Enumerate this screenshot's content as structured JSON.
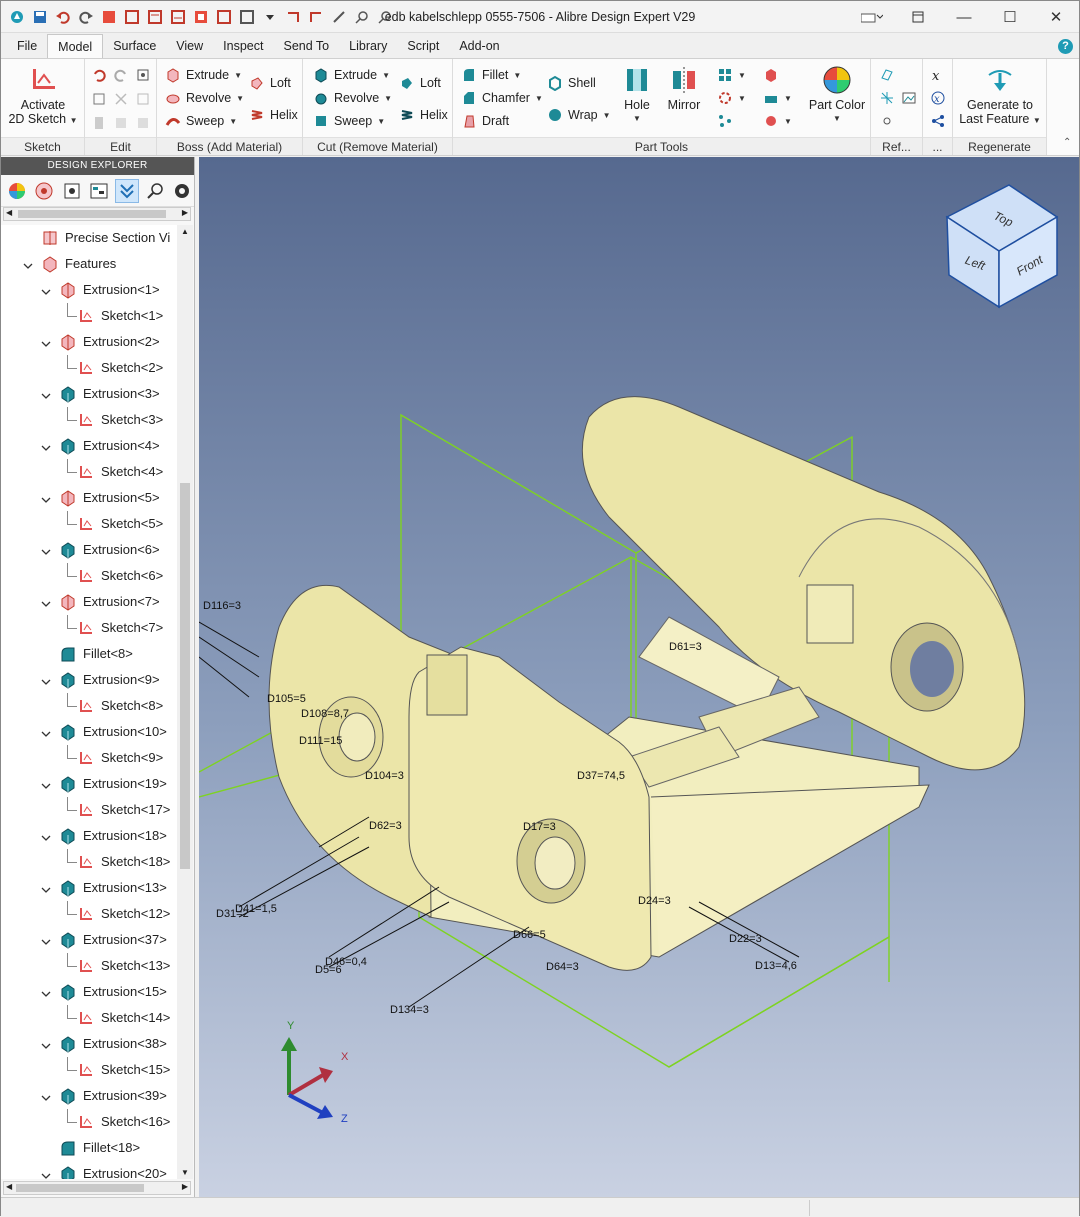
{
  "window": {
    "title": "edb kabelschlepp 0555-7506 - Alibre Design Expert V29",
    "minimize_glyph": "—",
    "maximize_glyph": "☐",
    "close_glyph": "✕"
  },
  "menu": [
    "File",
    "Model",
    "Surface",
    "View",
    "Inspect",
    "Send To",
    "Library",
    "Script",
    "Add-on"
  ],
  "help_glyph": "?",
  "ribbon": {
    "sketch": {
      "activate_line1": "Activate",
      "activate_line2": "2D Sketch",
      "label": "Sketch"
    },
    "edit": {
      "label": "Edit"
    },
    "boss": {
      "extrude": "Extrude",
      "revolve": "Revolve",
      "sweep": "Sweep",
      "loft": "Loft",
      "helix": "Helix",
      "label": "Boss (Add Material)"
    },
    "cut": {
      "extrude": "Extrude",
      "revolve": "Revolve",
      "sweep": "Sweep",
      "loft": "Loft",
      "helix": "Helix",
      "label": "Cut (Remove Material)"
    },
    "part_tools": {
      "fillet": "Fillet",
      "chamfer": "Chamfer",
      "draft": "Draft",
      "shell": "Shell",
      "wrap": "Wrap",
      "hole": "Hole",
      "mirror": "Mirror",
      "part_color": "Part Color",
      "label": "Part Tools"
    },
    "ref": {
      "label": "Ref..."
    },
    "more": {
      "label": "..."
    },
    "regenerate": {
      "line1": "Generate to",
      "line2": "Last Feature",
      "label": "Regenerate"
    }
  },
  "explorer": {
    "title": "DESIGN EXPLORER",
    "items": [
      {
        "label": "Precise Section Vi",
        "depth": 1,
        "icon": "section-icon",
        "toggle": ""
      },
      {
        "label": "Features",
        "depth": 1,
        "icon": "features-icon",
        "toggle": "v"
      },
      {
        "label": "Extrusion<1>",
        "depth": 2,
        "icon": "boss-icon",
        "toggle": "v"
      },
      {
        "label": "Sketch<1>",
        "depth": 3,
        "icon": "sketch-icon",
        "toggle": ""
      },
      {
        "label": "Extrusion<2>",
        "depth": 2,
        "icon": "boss-icon",
        "toggle": "v"
      },
      {
        "label": "Sketch<2>",
        "depth": 3,
        "icon": "sketch-icon",
        "toggle": ""
      },
      {
        "label": "Extrusion<3>",
        "depth": 2,
        "icon": "cut-icon",
        "toggle": "v"
      },
      {
        "label": "Sketch<3>",
        "depth": 3,
        "icon": "sketch-icon",
        "toggle": ""
      },
      {
        "label": "Extrusion<4>",
        "depth": 2,
        "icon": "cut-icon",
        "toggle": "v"
      },
      {
        "label": "Sketch<4>",
        "depth": 3,
        "icon": "sketch-icon",
        "toggle": ""
      },
      {
        "label": "Extrusion<5>",
        "depth": 2,
        "icon": "boss-icon",
        "toggle": "v"
      },
      {
        "label": "Sketch<5>",
        "depth": 3,
        "icon": "sketch-icon",
        "toggle": ""
      },
      {
        "label": "Extrusion<6>",
        "depth": 2,
        "icon": "cut-icon",
        "toggle": "v"
      },
      {
        "label": "Sketch<6>",
        "depth": 3,
        "icon": "sketch-icon",
        "toggle": ""
      },
      {
        "label": "Extrusion<7>",
        "depth": 2,
        "icon": "boss-icon",
        "toggle": "v"
      },
      {
        "label": "Sketch<7>",
        "depth": 3,
        "icon": "sketch-icon",
        "toggle": ""
      },
      {
        "label": "Fillet<8>",
        "depth": 2,
        "icon": "fillet-icon",
        "toggle": ""
      },
      {
        "label": "Extrusion<9>",
        "depth": 2,
        "icon": "cut-icon",
        "toggle": "v"
      },
      {
        "label": "Sketch<8>",
        "depth": 3,
        "icon": "sketch-icon",
        "toggle": ""
      },
      {
        "label": "Extrusion<10>",
        "depth": 2,
        "icon": "cut-icon",
        "toggle": "v"
      },
      {
        "label": "Sketch<9>",
        "depth": 3,
        "icon": "sketch-icon",
        "toggle": ""
      },
      {
        "label": "Extrusion<19>",
        "depth": 2,
        "icon": "cut-icon",
        "toggle": "v"
      },
      {
        "label": "Sketch<17>",
        "depth": 3,
        "icon": "sketch-icon",
        "toggle": ""
      },
      {
        "label": "Extrusion<18>",
        "depth": 2,
        "icon": "cut-icon",
        "toggle": "v"
      },
      {
        "label": "Sketch<18>",
        "depth": 3,
        "icon": "sketch-icon",
        "toggle": ""
      },
      {
        "label": "Extrusion<13>",
        "depth": 2,
        "icon": "cut-icon",
        "toggle": "v"
      },
      {
        "label": "Sketch<12>",
        "depth": 3,
        "icon": "sketch-icon",
        "toggle": ""
      },
      {
        "label": "Extrusion<37>",
        "depth": 2,
        "icon": "cut-icon",
        "toggle": "v"
      },
      {
        "label": "Sketch<13>",
        "depth": 3,
        "icon": "sketch-icon",
        "toggle": ""
      },
      {
        "label": "Extrusion<15>",
        "depth": 2,
        "icon": "cut-icon",
        "toggle": "v"
      },
      {
        "label": "Sketch<14>",
        "depth": 3,
        "icon": "sketch-icon",
        "toggle": ""
      },
      {
        "label": "Extrusion<38>",
        "depth": 2,
        "icon": "cut-icon",
        "toggle": "v"
      },
      {
        "label": "Sketch<15>",
        "depth": 3,
        "icon": "sketch-icon",
        "toggle": ""
      },
      {
        "label": "Extrusion<39>",
        "depth": 2,
        "icon": "cut-icon",
        "toggle": "v"
      },
      {
        "label": "Sketch<16>",
        "depth": 3,
        "icon": "sketch-icon",
        "toggle": ""
      },
      {
        "label": "Fillet<18>",
        "depth": 2,
        "icon": "fillet-icon",
        "toggle": ""
      },
      {
        "label": "Extrusion<20>",
        "depth": 2,
        "icon": "cut-icon",
        "toggle": "v"
      }
    ]
  },
  "viewcube": {
    "top": "Top",
    "left": "Left",
    "front": "Front"
  },
  "axes": {
    "x": "X",
    "y": "Y",
    "z": "Z"
  },
  "dimensions": [
    "D116=3",
    "D105=5",
    "D108=8,7",
    "D111=15",
    "D104=3",
    "D62=3",
    "D37=74,5",
    "D61=3",
    "D17=3",
    "D31=2",
    "D41=1,5",
    "D46=0,4",
    "D5=6",
    "D66=5",
    "D64=3",
    "D134=3",
    "D24=3",
    "D22=3",
    "D13=4,6"
  ],
  "colors": {
    "accent": "#1f9bb5",
    "model_face": "#efeab4",
    "sketch_line": "#7ed321",
    "viewport_top": "#56698f",
    "viewport_bottom": "#c9d1e2"
  }
}
